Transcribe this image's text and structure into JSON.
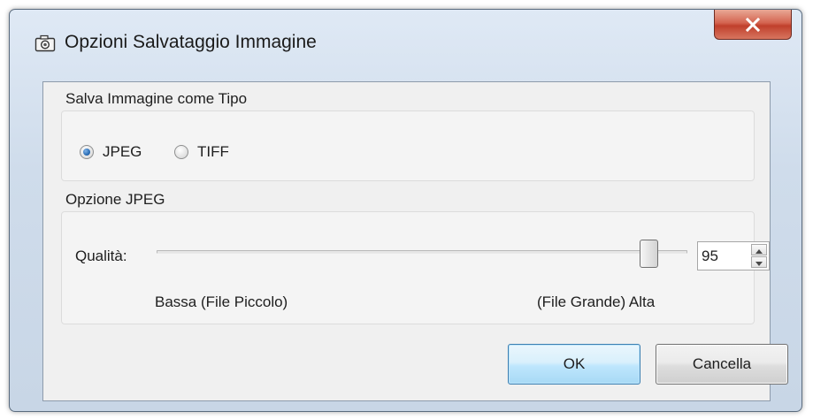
{
  "window": {
    "title": "Opzioni Salvataggio Immagine",
    "title_icon": "camera-icon",
    "close_icon": "close-icon"
  },
  "image_type_group": {
    "label": "Salva Immagine come Tipo",
    "options": [
      {
        "label": "JPEG",
        "selected": true
      },
      {
        "label": "TIFF",
        "selected": false
      }
    ]
  },
  "jpeg_group": {
    "label": "Opzione JPEG",
    "quality_label": "Qualità:",
    "quality_value": "95",
    "quality_min_label": "Bassa (File Piccolo)",
    "quality_max_label": "(File Grande) Alta",
    "slider_fraction": 0.92
  },
  "buttons": {
    "ok": "OK",
    "cancel": "Cancella"
  },
  "colors": {
    "ok_border": "#3c7fb1",
    "close_button": "#c0402c",
    "radio_selected": "#2a6db5"
  }
}
